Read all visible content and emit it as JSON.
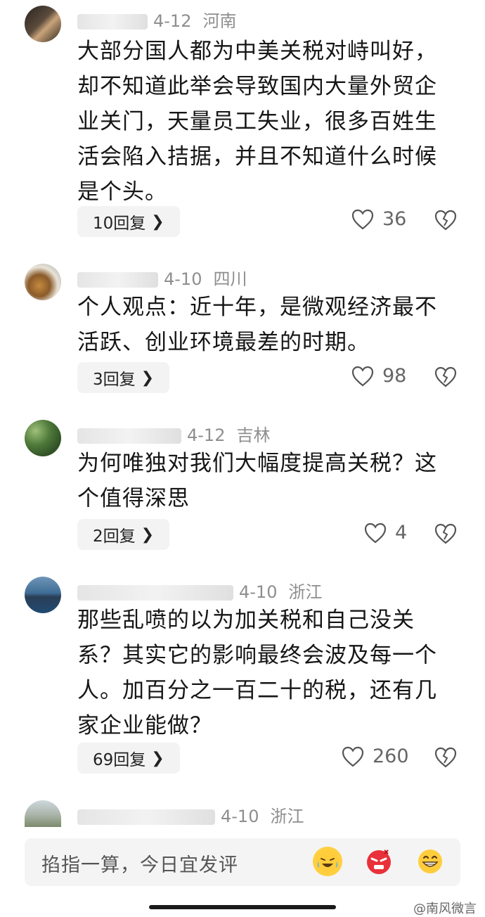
{
  "comments": [
    {
      "date": "4-12",
      "location": "河南",
      "text": "大部分国人都为中美关税对峙叫好，却不知道此举会导致国内大量外贸企业关门，天量员工失业，很多百姓生活会陷入拮据，并且不知道什么时候是个头。",
      "replies": "10回复",
      "likes": "36"
    },
    {
      "date": "4-10",
      "location": "四川",
      "text": "个人观点：近十年，是微观经济最不活跃、创业环境最差的时期。",
      "replies": "3回复",
      "likes": "98"
    },
    {
      "date": "4-12",
      "location": "吉林",
      "text": "为何唯独对我们大幅度提高关税？这个值得深思",
      "replies": "2回复",
      "likes": "4"
    },
    {
      "date": "4-10",
      "location": "浙江",
      "text": "那些乱喷的以为加关税和自己没关系？其实它的影响最终会波及每一个人。加百分之一百二十的税，还有几家企业能做？",
      "replies": "69回复",
      "likes": "260"
    },
    {
      "date": "4-10",
      "location": "浙江"
    }
  ],
  "input": {
    "placeholder": "掐指一算，今日宜发评"
  },
  "watermark": "@南风微言",
  "icons": {
    "like": "heart-outline-icon",
    "dislike": "broken-heart-icon",
    "reply_chevron": "chevron-right-icon",
    "emoji1": "crying-laughing-emoji-icon",
    "emoji2": "angry-face-emoji-icon",
    "emoji3": "grinning-face-emoji-icon"
  }
}
